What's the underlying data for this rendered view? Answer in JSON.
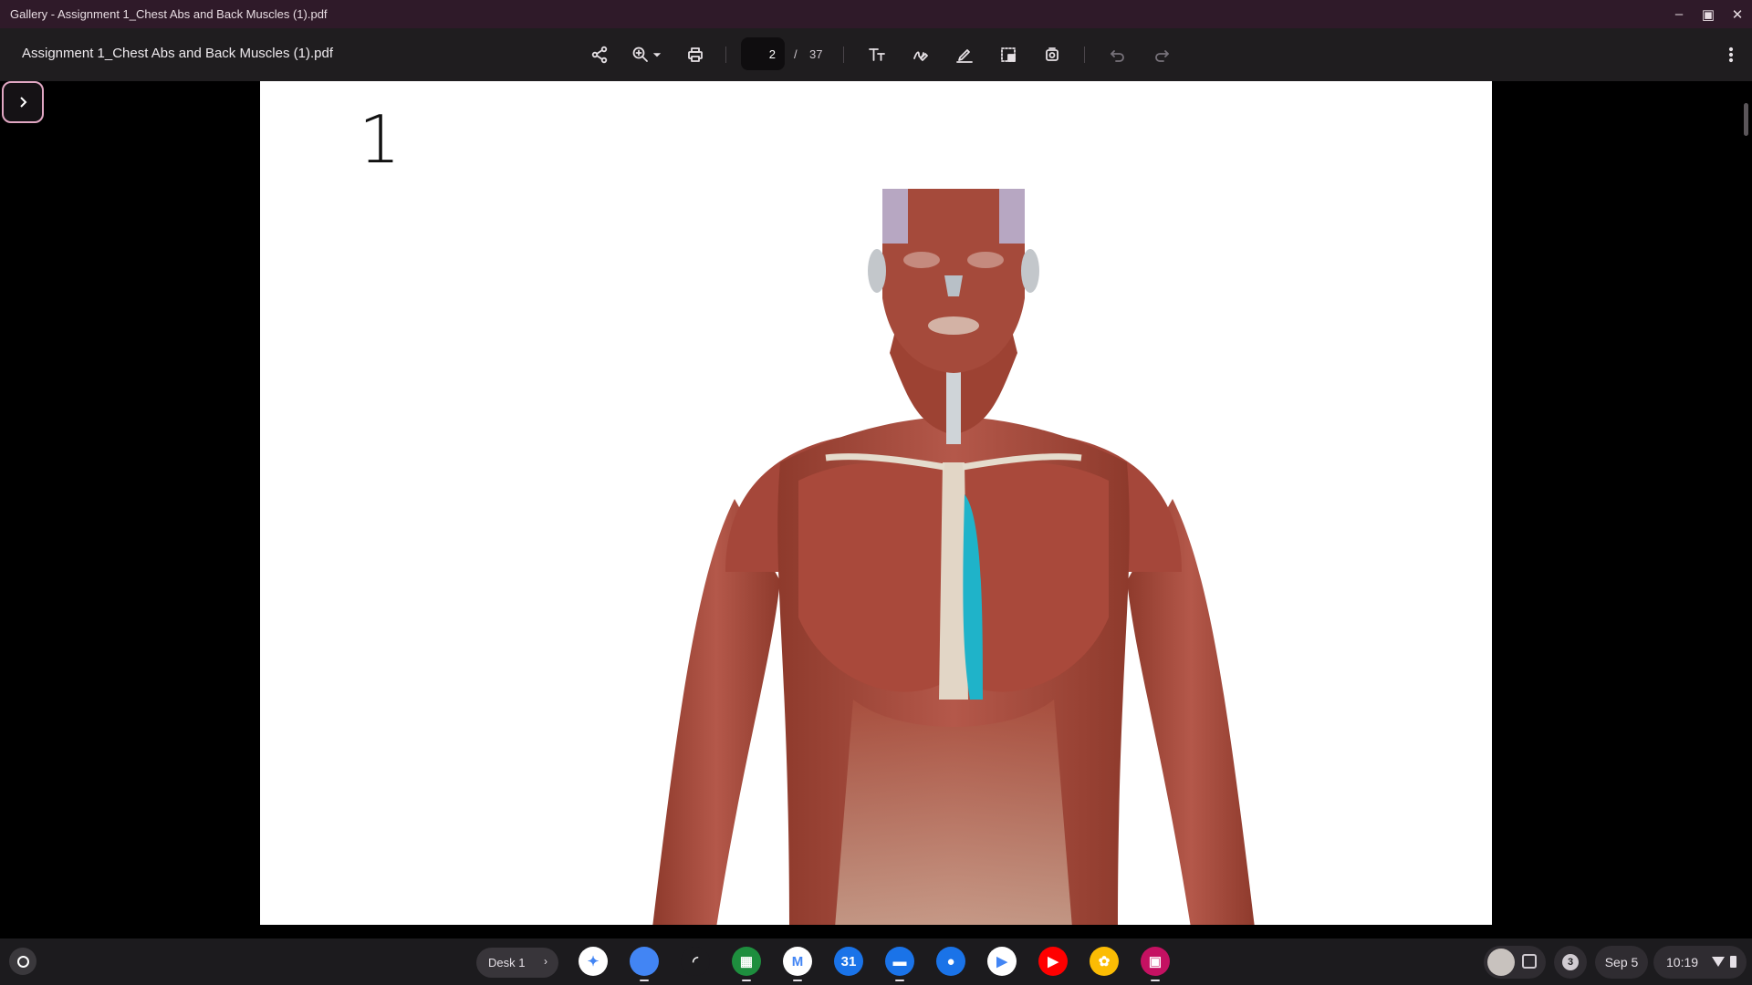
{
  "window": {
    "title": "Gallery - Assignment 1_Chest Abs and Back Muscles (1).pdf",
    "controls": [
      "minimize-icon",
      "restore-icon",
      "close-icon"
    ]
  },
  "toolbar": {
    "document_name": "Assignment 1_Chest Abs and Back Muscles (1).pdf",
    "current_page": "2",
    "page_separator": "/",
    "total_pages": "37",
    "icons": [
      "share-icon",
      "zoom-in-icon",
      "zoom-dropdown-icon",
      "print-icon",
      "text-icon",
      "draw-icon",
      "sign-icon",
      "select-icon",
      "rotate-icon",
      "undo-icon",
      "redo-icon",
      "more-icon"
    ]
  },
  "document": {
    "page_label": "1",
    "highlight_color": "#1fb3c9"
  },
  "shelf": {
    "desk_label": "Desk 1",
    "apps": [
      {
        "name": "assistant",
        "color": "#ffffff",
        "glyph": "✦"
      },
      {
        "name": "chrome",
        "color": "#4285f4",
        "glyph": ""
      },
      {
        "name": "cast",
        "color": "#1c1b1e",
        "glyph": "◜"
      },
      {
        "name": "apps",
        "color": "#1e8e3e",
        "glyph": "▦"
      },
      {
        "name": "gmail",
        "color": "#ffffff",
        "glyph": "M"
      },
      {
        "name": "calendar",
        "color": "#1a73e8",
        "glyph": "31"
      },
      {
        "name": "files",
        "color": "#1a73e8",
        "glyph": "▬"
      },
      {
        "name": "messages",
        "color": "#1a73e8",
        "glyph": "●"
      },
      {
        "name": "play-store",
        "color": "#ffffff",
        "glyph": "▶"
      },
      {
        "name": "youtube",
        "color": "#ff0000",
        "glyph": "▶"
      },
      {
        "name": "photos",
        "color": "#fbbc04",
        "glyph": "✿"
      },
      {
        "name": "gallery",
        "color": "#c51162",
        "glyph": "▣"
      }
    ],
    "notification_count": "3",
    "date": "Sep 5",
    "time": "10:19"
  }
}
